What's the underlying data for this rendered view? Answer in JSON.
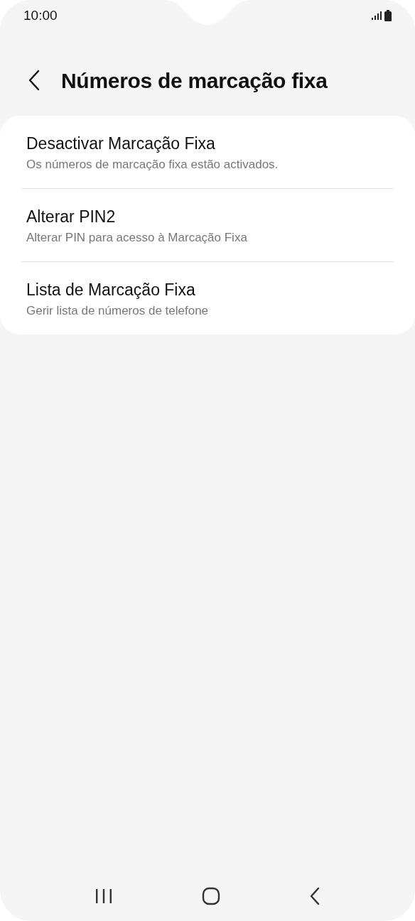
{
  "status_bar": {
    "time": "10:00"
  },
  "header": {
    "title": "Números de marcação fixa"
  },
  "items": [
    {
      "title": "Desactivar Marcação Fixa",
      "subtitle": "Os números de marcação fixa estão activados."
    },
    {
      "title": "Alterar PIN2",
      "subtitle": "Alterar PIN para acesso à Marcação Fixa"
    },
    {
      "title": "Lista de Marcação Fixa",
      "subtitle": "Gerir lista de números de telefone"
    }
  ]
}
